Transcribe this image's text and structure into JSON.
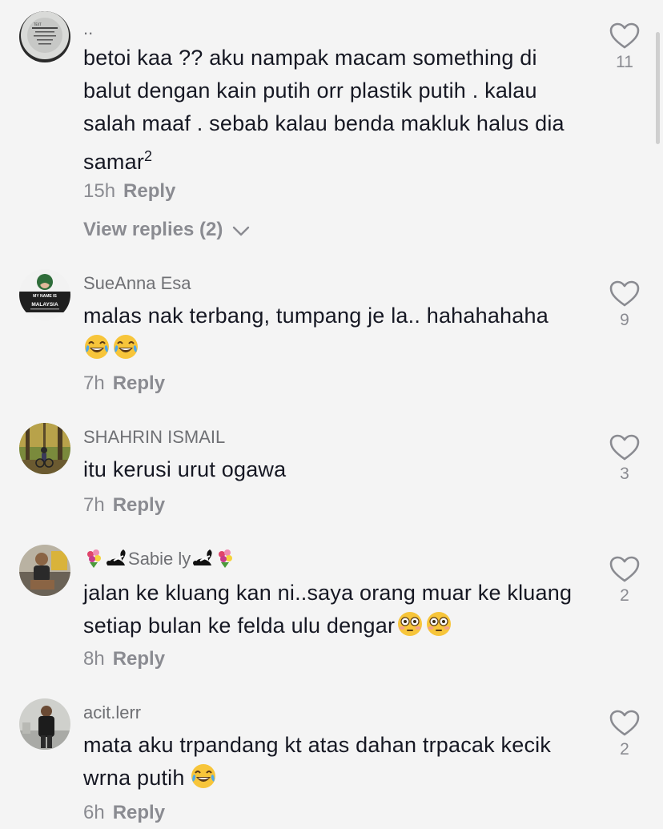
{
  "comments": [
    {
      "username": "..",
      "text": "betoi kaa ?? aku nampak macam something di balut dengan kain putih orr plastik putih . kalau salah maaf . sebab kalau benda makluk halus dia samar",
      "superscript": "2",
      "time": "15h",
      "reply_label": "Reply",
      "view_replies_label": "View replies (2)",
      "like_count": "11",
      "avatar_text": "IN THE PENDING MASTER POLICY"
    },
    {
      "username": "SueAnna Esa",
      "text": "malas nak terbang, tumpang je la.. hahahahaha",
      "time": "7h",
      "reply_label": "Reply",
      "like_count": "9",
      "avatar_text": {
        "line1": "MY NAME IS",
        "line2": "MALAYSIA"
      }
    },
    {
      "username": "SHAHRIN ISMAIL",
      "text": "itu kerusi urut ogawa",
      "time": "7h",
      "reply_label": "Reply",
      "like_count": "3"
    },
    {
      "username": "abie ly",
      "username_prefix": "S",
      "text": "jalan ke kluang kan ni..saya orang muar ke kluang setiap bulan ke felda ulu dengar",
      "time": "8h",
      "reply_label": "Reply",
      "like_count": "2"
    },
    {
      "username": "acit.lerr",
      "text": "mata aku trpandang kt atas dahan trpacak kecik wrna putih",
      "time": "6h",
      "reply_label": "Reply",
      "like_count": "2"
    }
  ],
  "icons": {
    "like": "heart-outline-icon",
    "expand": "chevron-down-icon",
    "emoji_laugh": "face-with-tears-of-joy-icon",
    "emoji_flushed": "flushed-face-icon",
    "flower": "bouquet-icon",
    "skunk": "skunk-icon"
  },
  "colors": {
    "background": "#f4f4f4",
    "text_primary": "#161823",
    "text_secondary": "#8a8b91"
  }
}
